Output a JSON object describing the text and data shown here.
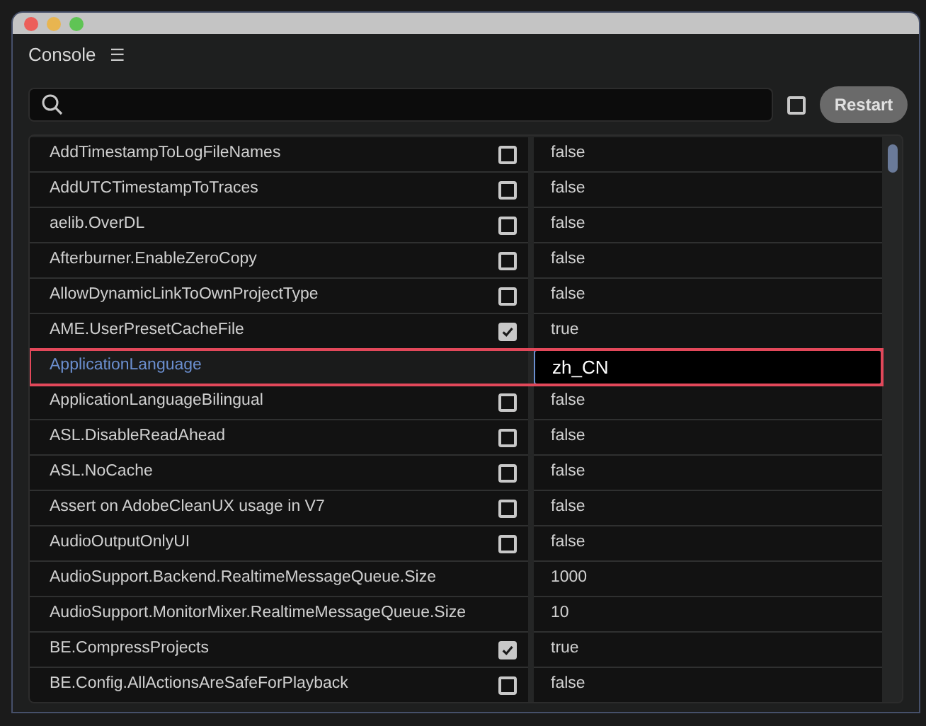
{
  "panel": {
    "title": "Console",
    "menu_icon": "☰"
  },
  "search": {
    "show_all_checked": false,
    "restart": "Restart"
  },
  "rows": [
    {
      "name": "AddTimestampToLogFileNames",
      "kind": "bool",
      "checked": false,
      "value": "false",
      "selected": false
    },
    {
      "name": "AddUTCTimestampToTraces",
      "kind": "bool",
      "checked": false,
      "value": "false",
      "selected": false
    },
    {
      "name": "aelib.OverDL",
      "kind": "bool",
      "checked": false,
      "value": "false",
      "selected": false
    },
    {
      "name": "Afterburner.EnableZeroCopy",
      "kind": "bool",
      "checked": false,
      "value": "false",
      "selected": false
    },
    {
      "name": "AllowDynamicLinkToOwnProjectType",
      "kind": "bool",
      "checked": false,
      "value": "false",
      "selected": false
    },
    {
      "name": "AME.UserPresetCacheFile",
      "kind": "bool",
      "checked": true,
      "value": "true",
      "selected": false
    },
    {
      "name": "ApplicationLanguage",
      "kind": "text",
      "value": "zh_CN",
      "selected": true
    },
    {
      "name": "ApplicationLanguageBilingual",
      "kind": "bool",
      "checked": false,
      "value": "false",
      "selected": false
    },
    {
      "name": "ASL.DisableReadAhead",
      "kind": "bool",
      "checked": false,
      "value": "false",
      "selected": false
    },
    {
      "name": "ASL.NoCache",
      "kind": "bool",
      "checked": false,
      "value": "false",
      "selected": false
    },
    {
      "name": "Assert on AdobeCleanUX usage in V7",
      "kind": "bool",
      "checked": false,
      "value": "false",
      "selected": false
    },
    {
      "name": "AudioOutputOnlyUI",
      "kind": "bool",
      "checked": false,
      "value": "false",
      "selected": false
    },
    {
      "name": "AudioSupport.Backend.RealtimeMessageQueue.Size",
      "kind": "text",
      "value": "1000",
      "selected": false
    },
    {
      "name": "AudioSupport.MonitorMixer.RealtimeMessageQueue.Size",
      "kind": "text",
      "value": "10",
      "selected": false
    },
    {
      "name": "BE.CompressProjects",
      "kind": "bool",
      "checked": true,
      "value": "true",
      "selected": false
    },
    {
      "name": "BE.Config.AllActionsAreSafeForPlayback",
      "kind": "bool",
      "checked": false,
      "value": "false",
      "selected": false
    }
  ]
}
